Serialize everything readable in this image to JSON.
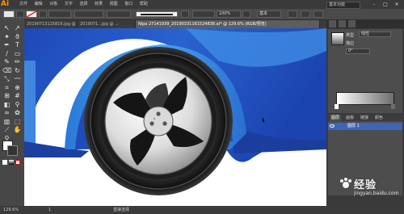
{
  "app": {
    "logo": "Ai",
    "menu": [
      "文件",
      "编辑",
      "对象",
      "文字",
      "选择",
      "效果",
      "视图",
      "窗口",
      "帮助"
    ],
    "workspace": "基本功能",
    "window_controls": [
      "–",
      "□",
      "✕"
    ]
  },
  "control_bar": {
    "fill_label": "",
    "stroke_label": "",
    "style_label": "",
    "opacity_value": "100%",
    "stroke_weight": "",
    "style_select": "基本"
  },
  "tabs": [
    {
      "label": "20190713115816.jpg @ ...",
      "active": false
    },
    {
      "label": "2019071...jpg @ ...",
      "active": false
    },
    {
      "label": "Nipa 27141939_20190331161524838.ai* @ 129.6% (RGB/预览)",
      "active": true
    },
    {
      "label": "× ",
      "active": false
    }
  ],
  "tools": [
    {
      "icon": "selection-tool-icon",
      "glyph": "↖"
    },
    {
      "icon": "direct-selection-tool-icon",
      "glyph": "↗"
    },
    {
      "icon": "magic-wand-icon",
      "glyph": "✦"
    },
    {
      "icon": "lasso-icon",
      "glyph": "ϑ"
    },
    {
      "icon": "pen-tool-icon",
      "glyph": "✒"
    },
    {
      "icon": "type-tool-icon",
      "glyph": "T"
    },
    {
      "icon": "line-tool-icon",
      "glyph": "/"
    },
    {
      "icon": "rectangle-tool-icon",
      "glyph": "▭"
    },
    {
      "icon": "brush-tool-icon",
      "glyph": "✎"
    },
    {
      "icon": "pencil-tool-icon",
      "glyph": "✏"
    },
    {
      "icon": "eraser-tool-icon",
      "glyph": "⌫"
    },
    {
      "icon": "rotate-tool-icon",
      "glyph": "↻"
    },
    {
      "icon": "scale-tool-icon",
      "glyph": "⤡"
    },
    {
      "icon": "warp-tool-icon",
      "glyph": "〰"
    },
    {
      "icon": "free-transform-icon",
      "glyph": "⌗"
    },
    {
      "icon": "shape-builder-icon",
      "glyph": "⊕"
    },
    {
      "icon": "perspective-grid-icon",
      "glyph": "⊞"
    },
    {
      "icon": "mesh-tool-icon",
      "glyph": "#"
    },
    {
      "icon": "gradient-tool-icon",
      "glyph": "◧"
    },
    {
      "icon": "eyedropper-icon",
      "glyph": "⚲"
    },
    {
      "icon": "blend-tool-icon",
      "glyph": "∞"
    },
    {
      "icon": "symbol-sprayer-icon",
      "glyph": "✿"
    },
    {
      "icon": "graph-tool-icon",
      "glyph": "▥"
    },
    {
      "icon": "artboard-tool-icon",
      "glyph": "⬚"
    },
    {
      "icon": "slice-tool-icon",
      "glyph": "⟋"
    },
    {
      "icon": "hand-tool-icon",
      "glyph": "✋"
    },
    {
      "icon": "zoom-tool-icon",
      "glyph": "⚲"
    }
  ],
  "gradient_panel": {
    "type_label": "类型",
    "type_value": "线性",
    "stroke_label": "描边",
    "angle_value": "0°",
    "opacity_label": "不透明度",
    "location_label": "位置"
  },
  "layers_panel": {
    "tabs": [
      "图层",
      "画板",
      "链接",
      "颜色"
    ],
    "layer_name": "图层 1"
  },
  "status_bar": {
    "zoom": "129.6%",
    "artboard": "1",
    "tool_name": "直接选择"
  },
  "watermark": {
    "text": "经验",
    "sub": "jingyan.baidu.com"
  },
  "colors": {
    "car_body": "#1e4fc0",
    "car_light": "#3d8ae0",
    "tire": "#1a1a1a",
    "accent": "#ff9a00"
  }
}
